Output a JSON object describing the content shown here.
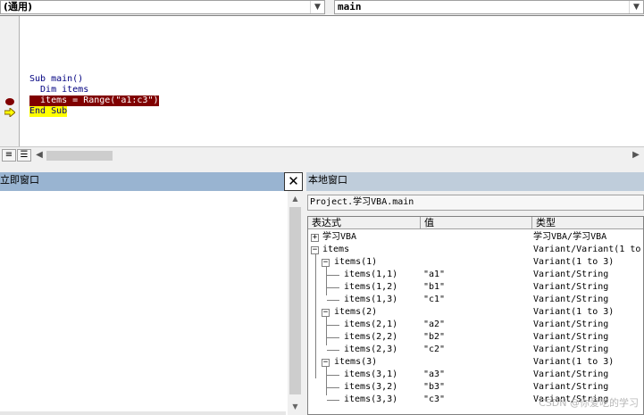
{
  "combos": {
    "object": "(通用)",
    "procedure": "main"
  },
  "code": {
    "lines": [
      {
        "text": "Sub main()",
        "style": "normal"
      },
      {
        "text": "  Dim items",
        "style": "normal"
      },
      {
        "text": "  items = Range(\"a1:c3\")",
        "style": "breakpoint"
      },
      {
        "text": "End Sub",
        "style": "current"
      }
    ],
    "colors": {
      "breakpoint": "#800000",
      "current_line": "#ffff00",
      "keyword": "#000080"
    }
  },
  "immediate": {
    "title": "立即窗口"
  },
  "locals": {
    "title": "本地窗口",
    "context": "Project.学习VBA.main",
    "columns": [
      "表达式",
      "值",
      "类型"
    ],
    "rows": [
      {
        "expr": "学习VBA",
        "value": "",
        "type": "学习VBA/学习VBA",
        "toggle": "+"
      },
      {
        "expr": "items",
        "value": "",
        "type": "Variant/Variant(1 to",
        "toggle": "-"
      },
      {
        "expr": "items(1)",
        "value": "",
        "type": "Variant(1 to 3)",
        "toggle": "-"
      },
      {
        "expr": "items(1,1)",
        "value": "\"a1\"",
        "type": "Variant/String",
        "toggle": ""
      },
      {
        "expr": "items(1,2)",
        "value": "\"b1\"",
        "type": "Variant/String",
        "toggle": ""
      },
      {
        "expr": "items(1,3)",
        "value": "\"c1\"",
        "type": "Variant/String",
        "toggle": ""
      },
      {
        "expr": "items(2)",
        "value": "",
        "type": "Variant(1 to 3)",
        "toggle": "-"
      },
      {
        "expr": "items(2,1)",
        "value": "\"a2\"",
        "type": "Variant/String",
        "toggle": ""
      },
      {
        "expr": "items(2,2)",
        "value": "\"b2\"",
        "type": "Variant/String",
        "toggle": ""
      },
      {
        "expr": "items(2,3)",
        "value": "\"c2\"",
        "type": "Variant/String",
        "toggle": ""
      },
      {
        "expr": "items(3)",
        "value": "",
        "type": "Variant(1 to 3)",
        "toggle": "-"
      },
      {
        "expr": "items(3,1)",
        "value": "\"a3\"",
        "type": "Variant/String",
        "toggle": ""
      },
      {
        "expr": "items(3,2)",
        "value": "\"b3\"",
        "type": "Variant/String",
        "toggle": ""
      },
      {
        "expr": "items(3,3)",
        "value": "\"c3\"",
        "type": "Variant/String",
        "toggle": ""
      }
    ]
  },
  "icons": {
    "breakpoint": "breakpoint-dot-icon",
    "execution": "execution-arrow-icon",
    "close": "close-icon",
    "expand": "plus-box-icon",
    "collapse": "minus-box-icon"
  },
  "watermark": "CSDN @你爱吃的学习"
}
